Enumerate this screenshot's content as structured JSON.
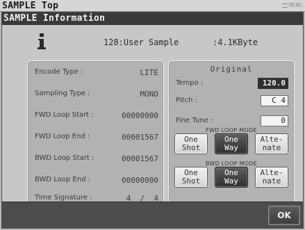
{
  "top": {
    "title": "SAMPLE Top",
    "mini_label": "MENU"
  },
  "dialog": {
    "title": "SAMPLE Information",
    "sample_name": "128:User Sample",
    "sample_size": ":4.1KByte"
  },
  "left_panel": {
    "rows": [
      {
        "label": "Encode Type :",
        "value": "LITE"
      },
      {
        "label": "Sampling Type :",
        "value": "MONO"
      },
      {
        "label": "FWD Loop Start :",
        "value": "00000000"
      },
      {
        "label": "FWD Loop End :",
        "value": "00001567"
      },
      {
        "label": "BWD Loop Start :",
        "value": "00001567"
      },
      {
        "label": "BWD Loop End :",
        "value": "00000000"
      },
      {
        "label": "Time Signature :",
        "value": "4  /  4"
      }
    ]
  },
  "right_panel": {
    "title": "Original",
    "tempo_label": "Tempo :",
    "tempo_value": "120.0",
    "pitch_label": "Pitch :",
    "pitch_value": "C 4",
    "fine_tune_label": "Fine Tune :",
    "fine_tune_value": "0",
    "fwd_mode_label": "FWD LOOP MODE",
    "bwd_mode_label": "BWD LOOP MODE",
    "fwd_buttons": [
      {
        "label": "One\nShot",
        "selected": false
      },
      {
        "label": "One\nWay",
        "selected": true
      },
      {
        "label": "Alte-\nnate",
        "selected": false
      }
    ],
    "bwd_buttons": [
      {
        "label": "One\nShot",
        "selected": false
      },
      {
        "label": "One\nWay",
        "selected": true
      },
      {
        "label": "Alte-\nnate",
        "selected": false
      }
    ]
  },
  "bottom": {
    "ok_label": "OK"
  }
}
